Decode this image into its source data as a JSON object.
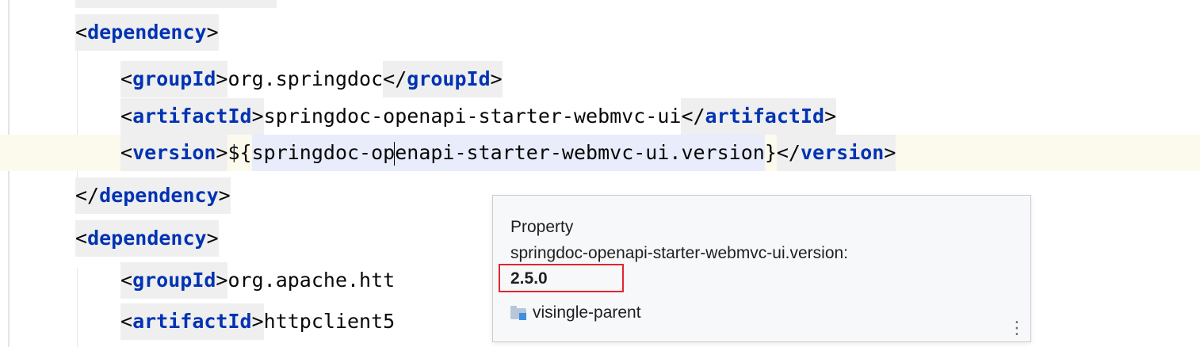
{
  "code": {
    "lines": [
      {
        "indent": "    ",
        "tokens": [
          {
            "t": "<",
            "k": "bracket"
          },
          {
            "t": "dependency",
            "k": "tag"
          },
          {
            "t": ">",
            "k": "bracket"
          }
        ]
      },
      {
        "indent": "        ",
        "tokens": [
          {
            "t": "<",
            "k": "bracket"
          },
          {
            "t": "groupId",
            "k": "tag"
          },
          {
            "t": ">",
            "k": "bracket"
          },
          {
            "t": "org.springdoc",
            "k": "text"
          },
          {
            "t": "</",
            "k": "bracket"
          },
          {
            "t": "groupId",
            "k": "tag"
          },
          {
            "t": ">",
            "k": "bracket"
          }
        ]
      },
      {
        "indent": "        ",
        "tokens": [
          {
            "t": "<",
            "k": "bracket"
          },
          {
            "t": "artifactId",
            "k": "tag"
          },
          {
            "t": ">",
            "k": "bracket"
          },
          {
            "t": "springdoc-openapi-starter-webmvc-ui",
            "k": "text"
          },
          {
            "t": "</",
            "k": "bracket"
          },
          {
            "t": "artifactId",
            "k": "tag"
          },
          {
            "t": ">",
            "k": "bracket"
          }
        ]
      },
      {
        "indent": "        ",
        "current": true,
        "tokens": [
          {
            "t": "<",
            "k": "bracket"
          },
          {
            "t": "version",
            "k": "tag"
          },
          {
            "t": ">",
            "k": "bracket"
          },
          {
            "t": "${",
            "k": "text"
          },
          {
            "t": "springdoc-op",
            "k": "prop"
          },
          {
            "t": "",
            "k": "caret"
          },
          {
            "t": "enapi-starter-webmvc-ui.version",
            "k": "prop"
          },
          {
            "t": "}",
            "k": "text"
          },
          {
            "t": "</",
            "k": "bracket"
          },
          {
            "t": "version",
            "k": "tag"
          },
          {
            "t": ">",
            "k": "bracket"
          }
        ]
      },
      {
        "indent": "    ",
        "tokens": [
          {
            "t": "</",
            "k": "bracket"
          },
          {
            "t": "dependency",
            "k": "tag"
          },
          {
            "t": ">",
            "k": "bracket"
          }
        ]
      },
      {
        "indent": "    ",
        "tokens": [
          {
            "t": "<",
            "k": "bracket"
          },
          {
            "t": "dependency",
            "k": "tag"
          },
          {
            "t": ">",
            "k": "bracket"
          }
        ]
      },
      {
        "indent": "        ",
        "tokens": [
          {
            "t": "<",
            "k": "bracket"
          },
          {
            "t": "groupId",
            "k": "tag"
          },
          {
            "t": ">",
            "k": "bracket"
          },
          {
            "t": "org.apache.htt",
            "k": "text"
          }
        ]
      },
      {
        "indent": "        ",
        "tokens": [
          {
            "t": "<",
            "k": "bracket"
          },
          {
            "t": "artifactId",
            "k": "tag"
          },
          {
            "t": ">",
            "k": "bracket"
          },
          {
            "t": "httpclient5",
            "k": "text"
          }
        ]
      }
    ]
  },
  "popup": {
    "kind": "Property",
    "property_name": "springdoc-openapi-starter-webmvc-ui.version:",
    "value": "2.5.0",
    "module": "visingle-parent",
    "module_icon": "module-folder-icon",
    "more_icon": "vertical-ellipsis-icon",
    "more_glyph": "⋮",
    "highlight_color": "#e0262f"
  },
  "colors": {
    "tag": "#0033b3",
    "text": "#080808",
    "current_line": "#fcfaed",
    "property_reference": "#e8ecfb",
    "tag_background": "#efefef"
  }
}
